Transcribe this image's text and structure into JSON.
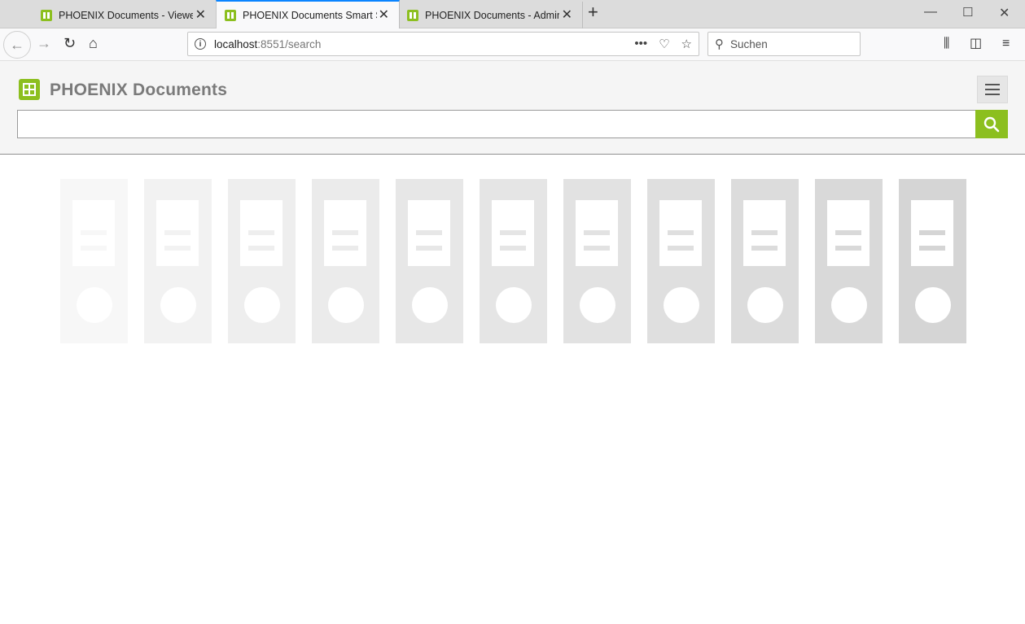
{
  "browser": {
    "tabs": [
      {
        "title": "PHOENIX Documents - Viewer",
        "active": false
      },
      {
        "title": "PHOENIX Documents Smart Search",
        "active": true
      },
      {
        "title": "PHOENIX Documents - Administration",
        "active": false
      }
    ],
    "url_host": "localhost",
    "url_path": ":8551/search",
    "search_placeholder": "Suchen"
  },
  "app": {
    "title": "PHOENIX Documents",
    "search_value": "",
    "accent_color": "#8cbf1f"
  },
  "loading_folders": {
    "count": 11,
    "shades": [
      "#f7f7f7",
      "#f2f2f2",
      "#eeeeee",
      "#ebebeb",
      "#e7e7e7",
      "#e5e5e5",
      "#e2e2e2",
      "#dfdfdf",
      "#dcdcdc",
      "#d9d9d9",
      "#d5d5d5"
    ]
  }
}
